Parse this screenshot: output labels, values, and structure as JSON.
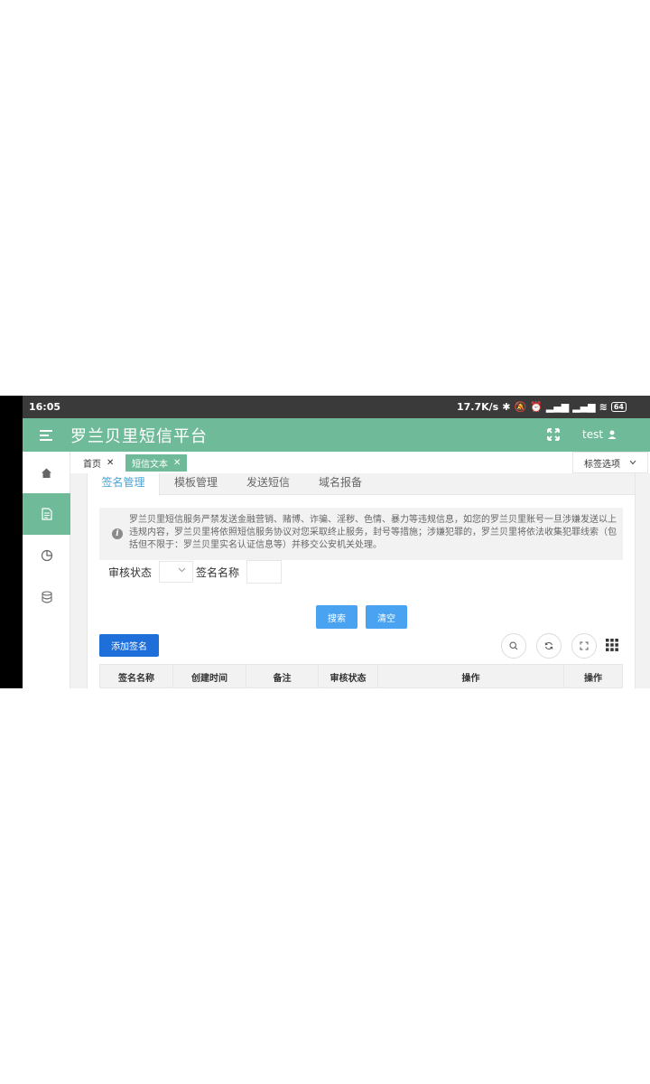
{
  "status_bar": {
    "time": "16:05",
    "net_speed": "17.7K/s",
    "battery": "64"
  },
  "header": {
    "title": "罗兰贝里短信平台",
    "user": "test"
  },
  "page_tabs": [
    {
      "label": "首页",
      "active": false
    },
    {
      "label": "短信文本",
      "active": true
    }
  ],
  "tab_options": "标签选项",
  "sub_tabs": [
    "签名管理",
    "模板管理",
    "发送短信",
    "域名报备"
  ],
  "notice": "罗兰贝里短信服务严禁发送金融营销、赌博、诈骗、淫秽、色情、暴力等违规信息，如您的罗兰贝里账号一旦涉嫌发送以上违规内容，罗兰贝里将依照短信服务协议对您采取终止服务，封号等措施；涉嫌犯罪的，罗兰贝里将依法收集犯罪线索（包括但不限于：罗兰贝里实名认证信息等）并移交公安机关处理。",
  "filters": {
    "status_label": "审核状态",
    "name_label": "签名名称"
  },
  "buttons": {
    "search": "搜索",
    "clear": "清空",
    "add_signature": "添加签名"
  },
  "table": {
    "columns": [
      "签名名称",
      "创建时间",
      "备注",
      "审核状态",
      "操作",
      "操作"
    ]
  },
  "colors": {
    "brand": "#6fbb99",
    "accent": "#4aa3f0",
    "primary_button": "#1e6fd9"
  }
}
